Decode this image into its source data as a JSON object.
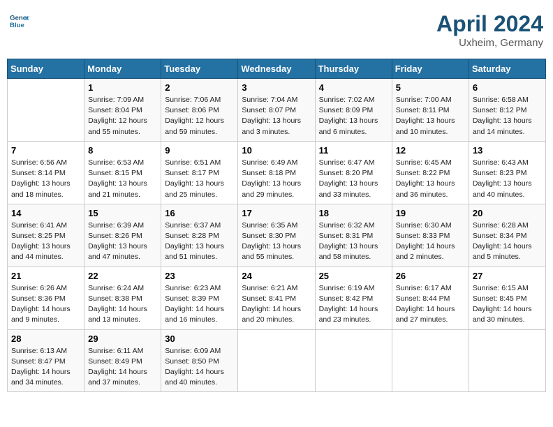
{
  "header": {
    "logo_line1": "General",
    "logo_line2": "Blue",
    "month_year": "April 2024",
    "location": "Uxheim, Germany"
  },
  "days_of_week": [
    "Sunday",
    "Monday",
    "Tuesday",
    "Wednesday",
    "Thursday",
    "Friday",
    "Saturday"
  ],
  "weeks": [
    [
      {
        "day": "",
        "info": ""
      },
      {
        "day": "1",
        "info": "Sunrise: 7:09 AM\nSunset: 8:04 PM\nDaylight: 12 hours\nand 55 minutes."
      },
      {
        "day": "2",
        "info": "Sunrise: 7:06 AM\nSunset: 8:06 PM\nDaylight: 12 hours\nand 59 minutes."
      },
      {
        "day": "3",
        "info": "Sunrise: 7:04 AM\nSunset: 8:07 PM\nDaylight: 13 hours\nand 3 minutes."
      },
      {
        "day": "4",
        "info": "Sunrise: 7:02 AM\nSunset: 8:09 PM\nDaylight: 13 hours\nand 6 minutes."
      },
      {
        "day": "5",
        "info": "Sunrise: 7:00 AM\nSunset: 8:11 PM\nDaylight: 13 hours\nand 10 minutes."
      },
      {
        "day": "6",
        "info": "Sunrise: 6:58 AM\nSunset: 8:12 PM\nDaylight: 13 hours\nand 14 minutes."
      }
    ],
    [
      {
        "day": "7",
        "info": "Sunrise: 6:56 AM\nSunset: 8:14 PM\nDaylight: 13 hours\nand 18 minutes."
      },
      {
        "day": "8",
        "info": "Sunrise: 6:53 AM\nSunset: 8:15 PM\nDaylight: 13 hours\nand 21 minutes."
      },
      {
        "day": "9",
        "info": "Sunrise: 6:51 AM\nSunset: 8:17 PM\nDaylight: 13 hours\nand 25 minutes."
      },
      {
        "day": "10",
        "info": "Sunrise: 6:49 AM\nSunset: 8:18 PM\nDaylight: 13 hours\nand 29 minutes."
      },
      {
        "day": "11",
        "info": "Sunrise: 6:47 AM\nSunset: 8:20 PM\nDaylight: 13 hours\nand 33 minutes."
      },
      {
        "day": "12",
        "info": "Sunrise: 6:45 AM\nSunset: 8:22 PM\nDaylight: 13 hours\nand 36 minutes."
      },
      {
        "day": "13",
        "info": "Sunrise: 6:43 AM\nSunset: 8:23 PM\nDaylight: 13 hours\nand 40 minutes."
      }
    ],
    [
      {
        "day": "14",
        "info": "Sunrise: 6:41 AM\nSunset: 8:25 PM\nDaylight: 13 hours\nand 44 minutes."
      },
      {
        "day": "15",
        "info": "Sunrise: 6:39 AM\nSunset: 8:26 PM\nDaylight: 13 hours\nand 47 minutes."
      },
      {
        "day": "16",
        "info": "Sunrise: 6:37 AM\nSunset: 8:28 PM\nDaylight: 13 hours\nand 51 minutes."
      },
      {
        "day": "17",
        "info": "Sunrise: 6:35 AM\nSunset: 8:30 PM\nDaylight: 13 hours\nand 55 minutes."
      },
      {
        "day": "18",
        "info": "Sunrise: 6:32 AM\nSunset: 8:31 PM\nDaylight: 13 hours\nand 58 minutes."
      },
      {
        "day": "19",
        "info": "Sunrise: 6:30 AM\nSunset: 8:33 PM\nDaylight: 14 hours\nand 2 minutes."
      },
      {
        "day": "20",
        "info": "Sunrise: 6:28 AM\nSunset: 8:34 PM\nDaylight: 14 hours\nand 5 minutes."
      }
    ],
    [
      {
        "day": "21",
        "info": "Sunrise: 6:26 AM\nSunset: 8:36 PM\nDaylight: 14 hours\nand 9 minutes."
      },
      {
        "day": "22",
        "info": "Sunrise: 6:24 AM\nSunset: 8:38 PM\nDaylight: 14 hours\nand 13 minutes."
      },
      {
        "day": "23",
        "info": "Sunrise: 6:23 AM\nSunset: 8:39 PM\nDaylight: 14 hours\nand 16 minutes."
      },
      {
        "day": "24",
        "info": "Sunrise: 6:21 AM\nSunset: 8:41 PM\nDaylight: 14 hours\nand 20 minutes."
      },
      {
        "day": "25",
        "info": "Sunrise: 6:19 AM\nSunset: 8:42 PM\nDaylight: 14 hours\nand 23 minutes."
      },
      {
        "day": "26",
        "info": "Sunrise: 6:17 AM\nSunset: 8:44 PM\nDaylight: 14 hours\nand 27 minutes."
      },
      {
        "day": "27",
        "info": "Sunrise: 6:15 AM\nSunset: 8:45 PM\nDaylight: 14 hours\nand 30 minutes."
      }
    ],
    [
      {
        "day": "28",
        "info": "Sunrise: 6:13 AM\nSunset: 8:47 PM\nDaylight: 14 hours\nand 34 minutes."
      },
      {
        "day": "29",
        "info": "Sunrise: 6:11 AM\nSunset: 8:49 PM\nDaylight: 14 hours\nand 37 minutes."
      },
      {
        "day": "30",
        "info": "Sunrise: 6:09 AM\nSunset: 8:50 PM\nDaylight: 14 hours\nand 40 minutes."
      },
      {
        "day": "",
        "info": ""
      },
      {
        "day": "",
        "info": ""
      },
      {
        "day": "",
        "info": ""
      },
      {
        "day": "",
        "info": ""
      }
    ]
  ]
}
